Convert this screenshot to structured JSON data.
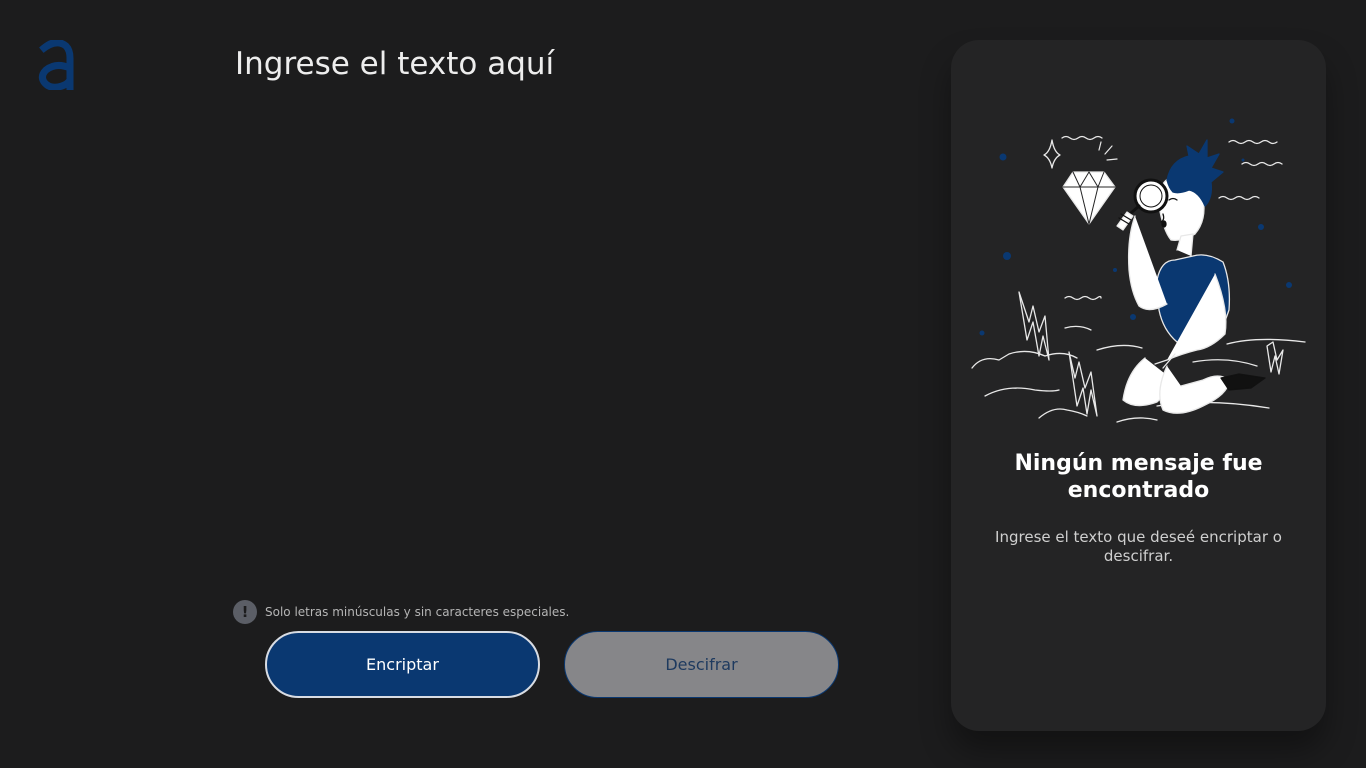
{
  "app": {
    "logo_icon": "alura-a-logo",
    "accent_color": "#0a3871"
  },
  "input": {
    "placeholder": "Ingrese el texto aquí",
    "value": ""
  },
  "hint": {
    "icon": "exclamation-icon",
    "text": "Solo letras minúsculas y sin caracteres especiales."
  },
  "buttons": {
    "encrypt_label": "Encriptar",
    "decrypt_label": "Descifrar"
  },
  "output": {
    "illustration": "person-with-magnifying-glass-and-diamond",
    "title": "Ningún mensaje fue encontrado",
    "description": "Ingrese el texto que deseé encriptar o descifrar."
  }
}
